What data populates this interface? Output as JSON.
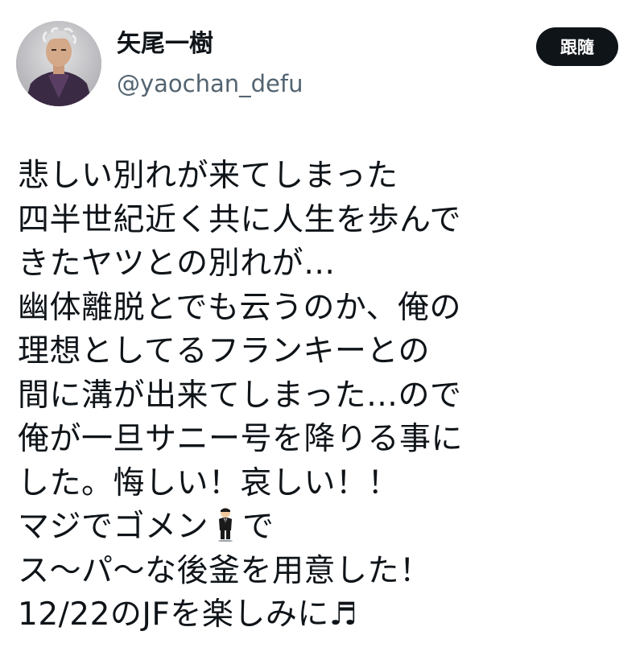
{
  "user": {
    "display_name": "矢尾一樹",
    "handle": "@yaochan_defu"
  },
  "follow_button": {
    "label": "跟隨"
  },
  "tweet": {
    "lines": [
      "悲しい別れが来てしまった",
      "四半世紀近く共に人生を歩んで",
      "きたヤツとの別れが…",
      "幽体離脱とでも云うのか、俺の",
      "理想としてるフランキーとの",
      "間に溝が出来てしまった…ので",
      "俺が一旦サニー号を降りる事に",
      "した。悔しい！哀しい！！",
      "マジでゴメン",
      "で",
      "ス～パ～な後釜を用意した！",
      "12/22のJFを楽しみに♬"
    ],
    "emoji_icon": "man-in-suit-levitating-icon"
  },
  "colors": {
    "text": "#0f1419",
    "secondary_text": "#536471",
    "button_bg": "#0f1419",
    "button_text": "#ffffff"
  }
}
